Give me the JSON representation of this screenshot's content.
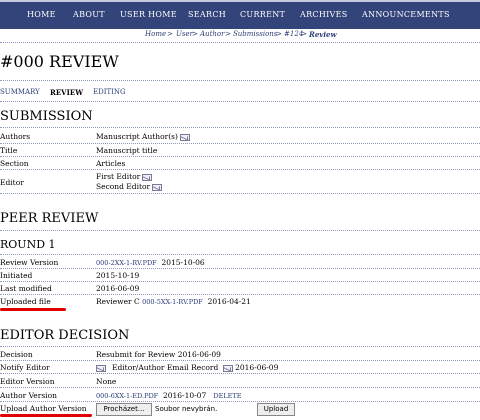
{
  "nav": [
    "HOME",
    "ABOUT",
    "USER HOME",
    "SEARCH",
    "CURRENT",
    "ARCHIVES",
    "ANNOUNCEMENTS"
  ],
  "breadcrumb": [
    "Home",
    "User",
    "Author",
    "Submissions",
    "#124",
    "Review"
  ],
  "breadcrumb_sep": ">",
  "page_title": "#000 REVIEW",
  "tabs": [
    "SUMMARY",
    "REVIEW",
    "EDITING"
  ],
  "submission": {
    "title": "SUBMISSION",
    "rows": [
      {
        "label": "Authors",
        "value": "Manuscript Author(s)"
      },
      {
        "label": "Title",
        "value": "Manuscript title"
      },
      {
        "label": "Section",
        "value": "Articles"
      },
      {
        "label": "Editor",
        "value": "First Editor",
        "value2": "Second Editor"
      }
    ]
  },
  "peer_review": {
    "title": "PEER REVIEW",
    "round": "ROUND 1",
    "rows": [
      {
        "label": "Review Version",
        "link": "000-2XX-1-RV.PDF",
        "value": "2015-10-06"
      },
      {
        "label": "Initiated",
        "value": "2015-10-19"
      },
      {
        "label": "Last modified",
        "value": "2016-06-09"
      },
      {
        "label": "Uploaded file",
        "prefix": "Reviewer C",
        "link": "000-5XX-1-RV.PDF",
        "value": "2016-04-21"
      }
    ]
  },
  "editor_decision": {
    "title": "EDITOR DECISION",
    "rows": [
      {
        "label": "Decision",
        "value": "Resubmit for Review 2016-06-09"
      },
      {
        "label": "Notify Editor",
        "value": "Editor/Author Email Record",
        "date": "2016-06-09"
      },
      {
        "label": "Editor Version",
        "value": "None"
      },
      {
        "label": "Author Version",
        "link": "000-6XX-1-ED.PDF",
        "value": "2016-10-07",
        "action": "DELETE"
      },
      {
        "label": "Upload Author Version",
        "browse": "Procházet...",
        "file_status": "Soubor nevybrán.",
        "upload": "Upload"
      }
    ]
  },
  "colors": {
    "nav_bg": "#33447a",
    "link": "#2c3e78",
    "highlight": "#e00000"
  }
}
